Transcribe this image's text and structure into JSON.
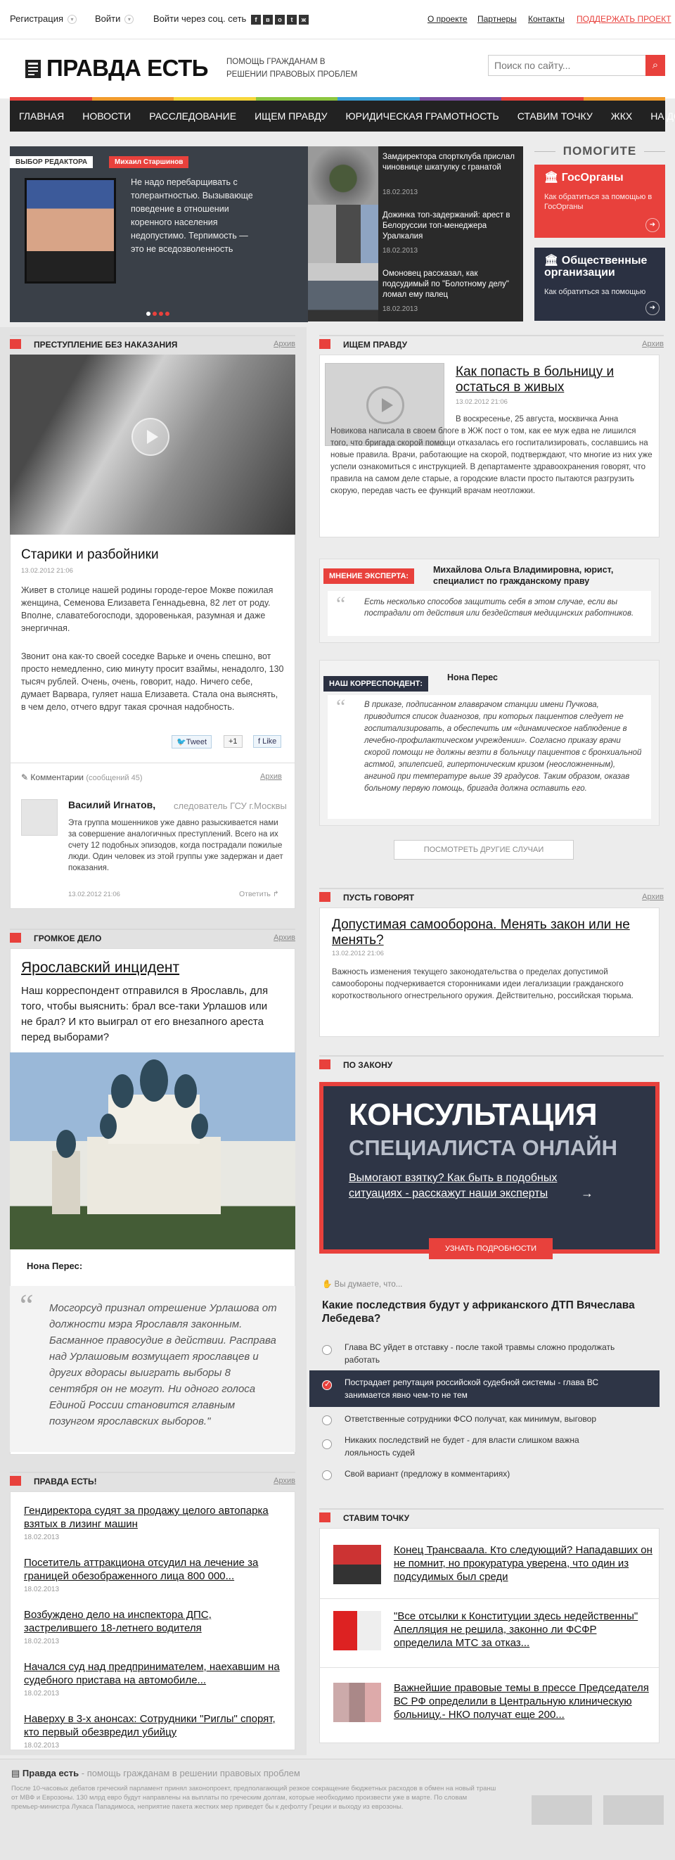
{
  "topbar": {
    "register": "Регистрация",
    "login": "Войти",
    "social_login": "Войти через соц. сеть",
    "about": "О проекте",
    "partners": "Партнеры",
    "contacts": "Контакты",
    "support": "ПОДДЕРЖАТЬ ПРОЕКТ",
    "social_icons": [
      "f",
      "vk",
      "ok",
      "tw",
      "lj"
    ]
  },
  "header": {
    "logo": "ПРАВДА ЕСТЬ",
    "slogan": "ПОМОЩЬ ГРАЖДАНАМ В РЕШЕНИИ ПРАВОВЫХ ПРОБЛЕМ",
    "search_placeholder": "Поиск по сайту..."
  },
  "nav": {
    "items": [
      "ГЛАВНАЯ",
      "НОВОСТИ",
      "РАССЛЕДОВАНИЕ",
      "ИЩЕМ ПРАВДУ",
      "ЮРИДИЧЕСКАЯ ГРАМОТНОСТЬ",
      "СТАВИМ ТОЧКУ",
      "ЖКХ",
      "НА ДОРОГЕ"
    ],
    "stripe_colors": [
      "#e8413c",
      "#f19b2c",
      "#f6d63b",
      "#8cc63f",
      "#3aa0d8",
      "#7a4ea0",
      "#e8413c",
      "#f19b2c"
    ]
  },
  "slider": {
    "label": "ВЫБОР РЕДАКТОРА",
    "author": "Михаил Старшинов",
    "quote": "Не надо перебарщивать с толерантностью. Вызывающе поведение в отношении коренного населения недопустимо. Терпимость — это не вседозволенность"
  },
  "side_news": [
    {
      "title": "Замдиректора спортклуба прислал чиновнице шкатулку с гранатой",
      "date": "18.02.2013"
    },
    {
      "title": "Дожинка топ-задержаний: арест в Белоруссии топ-менеджера Уралкалия",
      "date": "18.02.2013"
    },
    {
      "title": "Омоновец рассказал, как подсудимый по \"Болотному делу\" ломал ему палец",
      "date": "18.02.2013"
    }
  ],
  "help": {
    "title": "ПОМОГИТЕ",
    "box1_title": "ГосОрганы",
    "box1_sub": "Как обратиться за помощью в ГосОрганы",
    "box2_title": "Общественные организации",
    "box2_sub": "Как обратиться за помощью"
  },
  "crime": {
    "section": "ПРЕСТУПЛЕНИЕ БЕЗ НАКАЗАНИЯ",
    "archive": "Архив",
    "title": "Старики и разбойники",
    "date": "13.02.2012 21:06",
    "p1": "Живет в столице нашей родины городе-герое Мокве пожилая женщина, Семенова Елизавета Геннадьевна, 82 лет от роду. Вполне, славатебогосподи, здоровенькая, разумная и даже энергичная.",
    "p2": "Звонит она как-то своей соседке Варьке и очень спешно, вот просто немедленно, сию минуту просит взаймы, ненадолго, 130 тысяч рублей. Очень, очень, говорит, надо. Ничего себе, думает Варвара, гуляет наша Елизавета. Стала она выяснять, в чем дело, отчего вдруг такая срочная надобность.",
    "tweet": "Tweet",
    "plus": "+1",
    "like": "Like",
    "comments": "Комментарии",
    "comments_count": "(сообщений 45)",
    "comments_archive": "Архив",
    "commenter": "Василий Игнатов,",
    "commenter_role": "следователь ГСУ г.Москвы",
    "comment": "Эта группа мошенников уже давно разыскивается нами за совершение аналогичных преступлений. Всего на их счету 12 подобных эпизодов, когда пострадали пожилые люди. Один человек из этой группы уже задержан и дает показания.",
    "comment_date": "13.02.2012 21:06",
    "reply": "Ответить"
  },
  "loud": {
    "section": "ГРОМКОЕ ДЕЛО",
    "archive": "Архив",
    "title": "Ярославский инцидент",
    "lead": "Наш корреспондент отправился в Ярославль, для того, чтобы выяснить: брал все-таки Урлашов или не брал? И кто выиграл от его внезапного ареста перед выборами?",
    "author": "Нона Перес:",
    "quote": "Мосгорсуд признал отрешение Урлашова от должности мэра Ярославля законным. Басманное правосудие в действии. Расправа над Урлашовым возмущает ярославцев и других вдорасы выиграть выборы 8 сентября он не могут. Ни одного голоса Единой России становится главным позунгом ярославских выборов.\""
  },
  "truth_list": {
    "section": "ПРАВДА ЕСТЬ!",
    "archive": "Архив",
    "items": [
      {
        "title": "Гендиректора судят за продажу целого автопарка взятых в лизинг машин",
        "date": "18.02.2013"
      },
      {
        "title": "Посетитель аттракциона отсудил на лечение за границей обезображенного лица 800 000...",
        "date": "18.02.2013"
      },
      {
        "title": "Возбуждено дело на инспектора ДПС, застрелившего 18-летнего водителя",
        "date": "18.02.2013"
      },
      {
        "title": "Начался суд над предпринимателем, наехавшим на судебного пристава на автомобиле...",
        "date": "18.02.2013"
      },
      {
        "title": "Наверху в 3-х анонсах: Сотрудники \"Риглы\" спорят, кто первый обезвредил убийцу",
        "date": "18.02.2013"
      }
    ]
  },
  "seek": {
    "section": "ИЩЕМ ПРАВДУ",
    "archive": "Архив",
    "title": "Как попасть в больницу и остаться в живых",
    "date": "13.02.2012 21:06",
    "text": "В воскресенье, 25 августа, москвичка Анна Новикова написала в своем блоге в ЖЖ пост о том, как ее муж едва не лишился того, что бригада скорой помощи отказалась его госпитализировать, сославшись на новые правила. Врачи, работающие на скорой, подтверждают, что многие из них уже успели ознакомиться с инструкцией. В департаменте здравоохранения говорят, что правила на самом деле старые, а городские власти просто пытаются разгрузить скорую, передав часть ее функций врачам неотложки.",
    "expert_label": "МНЕНИЕ ЭКСПЕРТА:",
    "expert_name": "Михайлова Ольга Владимировна, юрист, специалист по гражданскому праву",
    "expert_quote": "Есть несколько способов защитить себя в этом случае, если вы пострадали от действия или бездействия медицинских работников.",
    "corr_label": "НАШ КОРРЕСПОНДЕНТ:",
    "corr_name": "Нона Перес",
    "corr_quote": "В приказе, подписанном главврачом станции имени Пучкова, приводится список диагнозов, при которых пациентов следует не госпитализировать, а обеспечить им «динамическое наблюдение в лечебно-профилактическом учреждении». Согласно приказу врачи скорой помощи не должны везти в больницу пациентов с бронхиальной астмой, эпилепсией, гипертоническим кризом (неосложненным), ангиной при температуре выше 39 градусов. Таким образом, оказав больному первую помощь, бригада должна оставить его.",
    "more": "ПОСМОТРЕТЬ ДРУГИЕ СЛУЧАИ"
  },
  "speak": {
    "section": "ПУСТЬ ГОВОРЯТ",
    "archive": "Архив",
    "title": "Допустимая самооборона. Менять закон или не менять?",
    "date": "13.02.2012 21:06",
    "text": "Важность изменения текущего законодательства о пределах допустимой самообороны подчеркивается сторонниками идеи легализации гражданского короткоствольного огнестрельного оружия. Действительно, российская тюрьма."
  },
  "law": {
    "section": "ПО ЗАКОНУ",
    "banner_line1": "КОНСУЛЬТАЦИЯ",
    "banner_line2": "СПЕЦИАЛИСТА ОНЛАЙН",
    "banner_text": "Вымогают взятку? Как быть в подобных ситуациях - расскажут наши эксперты",
    "banner_btn": "УЗНАТЬ ПОДРОБНОСТИ"
  },
  "poll": {
    "label": "Вы думаете, что...",
    "question": "Какие последствия будут у африканского ДТП Вячеслава Лебедева?",
    "options": [
      "Глава ВС уйдет в отставку - после такой травмы сложно продолжать работать",
      "Пострадает репутация российской судебной системы - глава ВС занимается явно чем-то не тем",
      "Ответственные сотрудники ФСО получат, как минимум, выговор",
      "Никаких последствий не будет - для власти слишком важна лояльность судей",
      "Свой вариант (предложу в комментариях)"
    ],
    "selected": 1
  },
  "point": {
    "section": "СТАВИМ ТОЧКУ",
    "items": [
      {
        "title": "Конец Трансваала. Кто следующий? Нападавших он не помнит, но прокуратура уверена, что один из подсудимых был среди"
      },
      {
        "title": "\"Все отсылки к Конституции здесь недейственны\" Апелляция не решила, законно ли ФСФР определила МТС за отказ..."
      },
      {
        "title": "Важнейшие правовые темы в прессе Председателя ВС РФ определили в Центральную клиническую больницу.- НКО получат еще 200..."
      }
    ]
  },
  "footer": {
    "logo": "Правда есть",
    "slogan": "- помощь гражданам в решении правовых проблем",
    "text": "После 10-часовых дебатов греческий парламент принял законопроект, предполагающий резкое сокращение бюджетных расходов в обмен на новый транш от МВФ и Еврозоны. 130 млрд евро будут направлены на выплаты по греческим долгам, которые необходимо произвести уже в марте. По словам премьер-министра Лукаса Пападимоса, неприятие пакета жестких мер приведет бы к дефолту Греции и выходу из еврозоны."
  },
  "colors": {
    "accent": "#e8413c",
    "dark": "#222222",
    "navy": "#2b3142"
  }
}
